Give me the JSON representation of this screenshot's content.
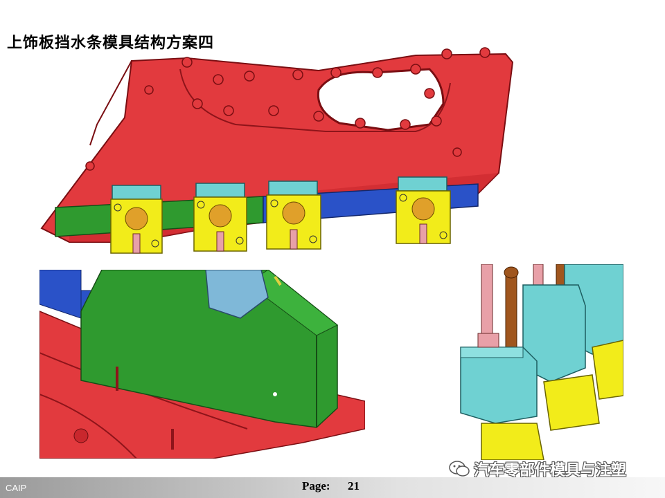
{
  "slide": {
    "title": "上饰板挡水条模具结构方案四"
  },
  "figures": [
    {
      "id": "top",
      "content": "3D CAD model of upper door trim panel with water strip mold lifters"
    },
    {
      "id": "bottom-left",
      "content": "close-up of green insert block on red part"
    },
    {
      "id": "bottom-right",
      "content": "close-up of lifter heads and rods"
    }
  ],
  "colors": {
    "part_red": "#e8343a",
    "insert_green": "#2f9a2f",
    "insert_blue": "#2a52c8",
    "lifter_yellow": "#f2ec1a",
    "lifter_cyan": "#6fd1d2",
    "rod_pink": "#e8a0a8",
    "rod_brown": "#a0561e"
  },
  "footer": {
    "company": "CAIP",
    "page_label": "Page:",
    "page_number": "21"
  },
  "watermark": {
    "icon": "wechat-icon",
    "text": "汽车零部件模具与注塑"
  }
}
